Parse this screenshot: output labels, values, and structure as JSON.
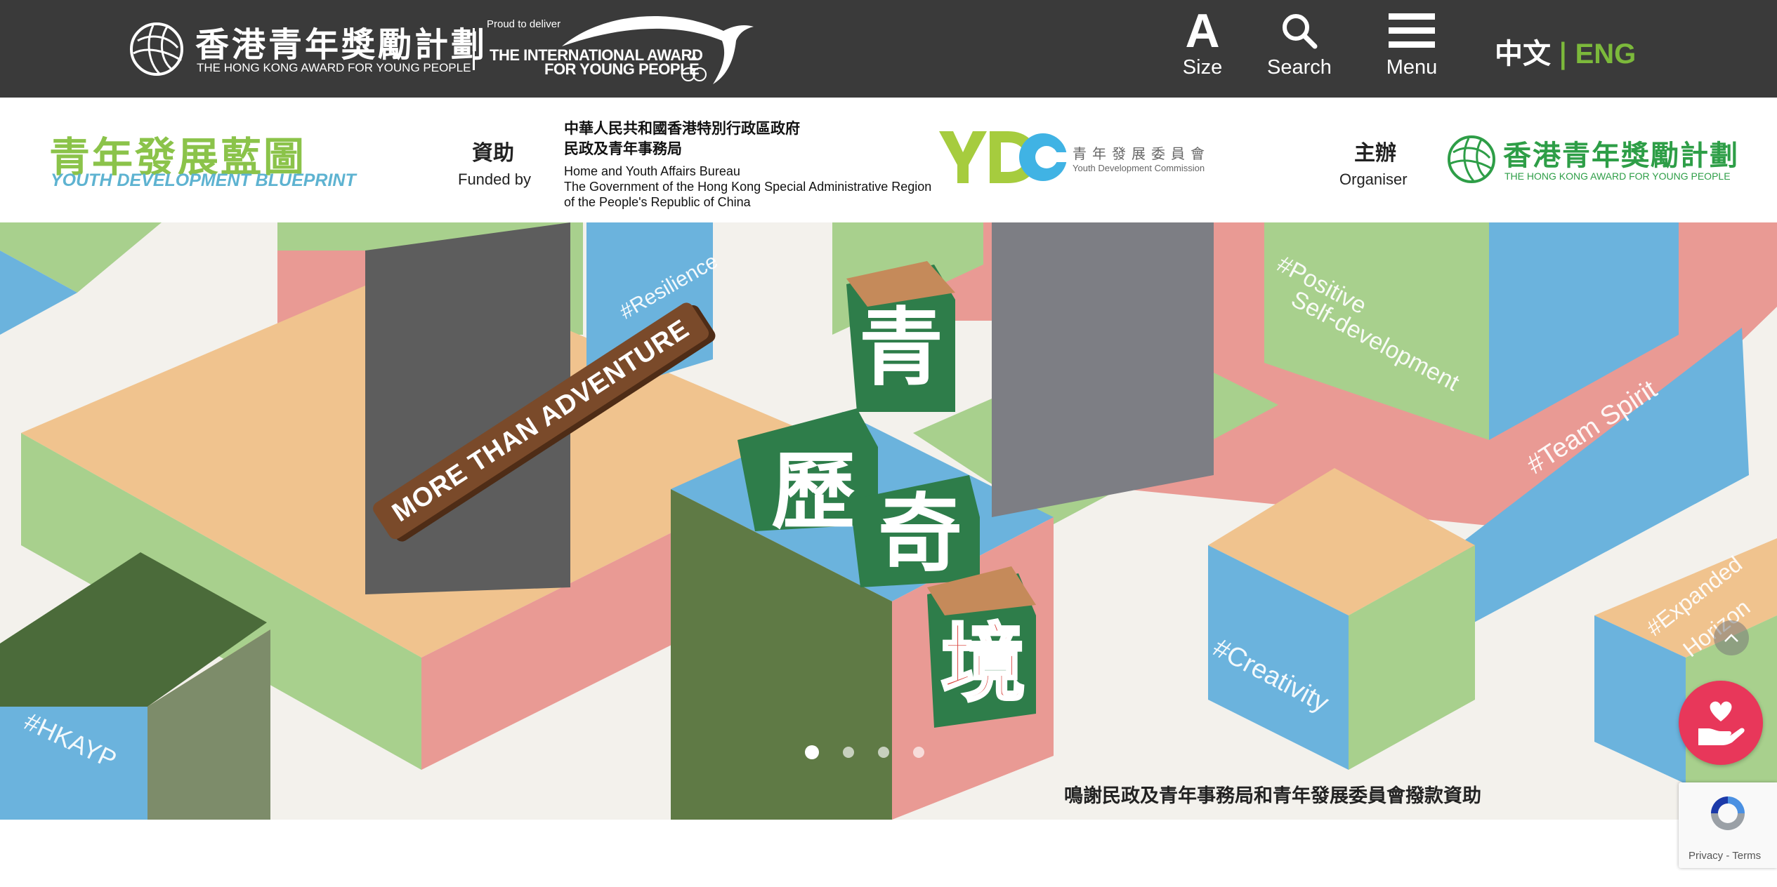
{
  "header": {
    "brand_cn": "香港青年獎勵計劃",
    "brand_en": "THE HONG KONG AWARD FOR YOUNG PEOPLE",
    "proud": "Proud to deliver",
    "intl_line1": "THE INTERNATIONAL AWARD",
    "intl_line2": "FOR YOUNG PEOPLE",
    "size_glyph": "A",
    "size_label": "Size",
    "search_label": "Search",
    "menu_label": "Menu",
    "lang_zh": "中文",
    "lang_sep": "|",
    "lang_en": "ENG",
    "lang_active_color": "#7cb93b"
  },
  "sponsor": {
    "ydb_cn": "青年發展藍圖",
    "ydb_en": "YOUTH DEVELOPMENT BLUEPRINT",
    "funded_cn": "資助",
    "funded_en": "Funded by",
    "gov_cn1": "中華人民共和國香港特別行政區政府",
    "gov_cn2": "民政及青年事務局",
    "gov_en1": "Home and Youth Affairs Bureau",
    "gov_en2": "The Government of the Hong Kong Special Administrative Region",
    "gov_en3": "of the People's Republic of China",
    "ydc_cn": "青年發展委員會",
    "ydc_en": "Youth Development Commission",
    "org_cn": "主辦",
    "org_en": "Organiser",
    "hk_cn": "香港青年獎勵計劃",
    "hk_en": "THE HONG KONG AWARD FOR YOUNG PEOPLE"
  },
  "banner": {
    "adventure": "MORE THAN ADVENTURE",
    "char1": "青",
    "char2": "歷",
    "char3": "奇",
    "char4": "境",
    "tag_resilience": "#Resilience",
    "tag_positive1": "#Positive",
    "tag_positive2": "Self-development",
    "tag_teamspirit": "#Team Spirit",
    "tag_creativity": "#Creativity",
    "tag_hkayp": "#HKAYP",
    "tag_expanded1": "#Expanded",
    "tag_expanded2": "Horizon",
    "thanks": "鳴謝民政及青年事務局和青年發展委員會撥款資助",
    "slides": [
      true,
      false,
      false,
      false
    ],
    "colors": {
      "green": "#a8d08d",
      "blue": "#6bb3dd",
      "pink": "#e99a94",
      "tan": "#f0c38e"
    }
  },
  "widgets": {
    "recaptcha_text": "Privacy - Terms",
    "donate_color": "#e8375a"
  }
}
